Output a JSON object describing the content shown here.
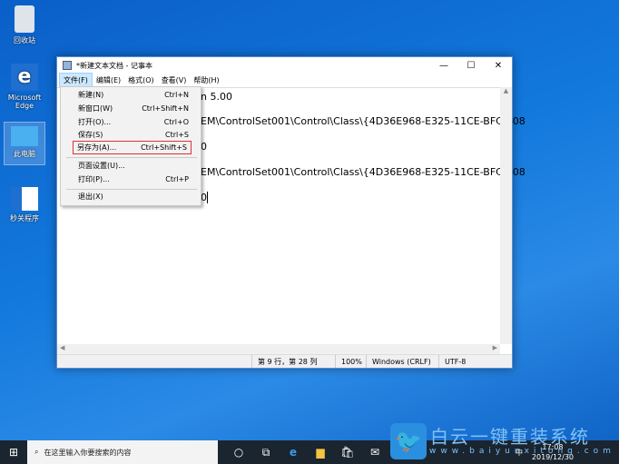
{
  "desktop": {
    "icons": [
      {
        "label": "回收站"
      },
      {
        "label": "Microsoft Edge"
      },
      {
        "label": "此电脑"
      },
      {
        "label": "秒关程序"
      }
    ]
  },
  "window": {
    "title": "*新建文本文档 - 记事本",
    "controls": {
      "minimize": "—",
      "maximize": "☐",
      "close": "✕"
    },
    "menubar": [
      "文件(F)",
      "编辑(E)",
      "格式(O)",
      "查看(V)",
      "帮助(H)"
    ],
    "lines": [
      "n 5.00",
      "EM\\ControlSet001\\Control\\Class\\{4D36E968-E325-11CE-BFC1-08",
      "0",
      "EM\\ControlSet001\\Control\\Class\\{4D36E968-E325-11CE-BFC1-08",
      "0"
    ],
    "status": {
      "position": "第 9 行，第 28 列",
      "zoom": "100%",
      "line_ending": "Windows (CRLF)",
      "encoding": "UTF-8"
    }
  },
  "file_menu": [
    {
      "label": "新建(N)",
      "shortcut": "Ctrl+N"
    },
    {
      "label": "新窗口(W)",
      "shortcut": "Ctrl+Shift+N"
    },
    {
      "label": "打开(O)...",
      "shortcut": "Ctrl+O"
    },
    {
      "label": "保存(S)",
      "shortcut": "Ctrl+S"
    },
    {
      "label": "另存为(A)...",
      "shortcut": "Ctrl+Shift+S"
    },
    {
      "label": "页面设置(U)...",
      "shortcut": ""
    },
    {
      "label": "打印(P)...",
      "shortcut": "Ctrl+P"
    },
    {
      "label": "退出(X)",
      "shortcut": ""
    }
  ],
  "taskbar": {
    "search_placeholder": "在这里输入你要搜索的内容",
    "time": "17:08",
    "date": "2019/12/30",
    "ime": "中"
  },
  "watermark": {
    "text": "白云一键重装系统",
    "url": "www.baiyunxitong.com"
  },
  "colors": {
    "highlight_border": "#e03030",
    "desktop": "#1379dc"
  }
}
